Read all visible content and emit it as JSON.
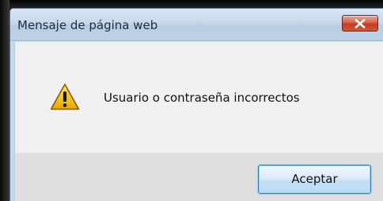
{
  "dialog": {
    "title": "Mensaje de página web",
    "message": "Usuario o contraseña incorrectos",
    "ok_label": "Aceptar"
  },
  "icons": {
    "status": "warning-icon",
    "close": "close-icon"
  },
  "colors": {
    "titlebar": "#c5d7ea",
    "close_button": "#c33b22",
    "content_bg": "#f0f0f0",
    "footer_bg": "#dfdfdf",
    "warning_fill": "#f5c400",
    "ok_border": "#3c7fb1"
  }
}
